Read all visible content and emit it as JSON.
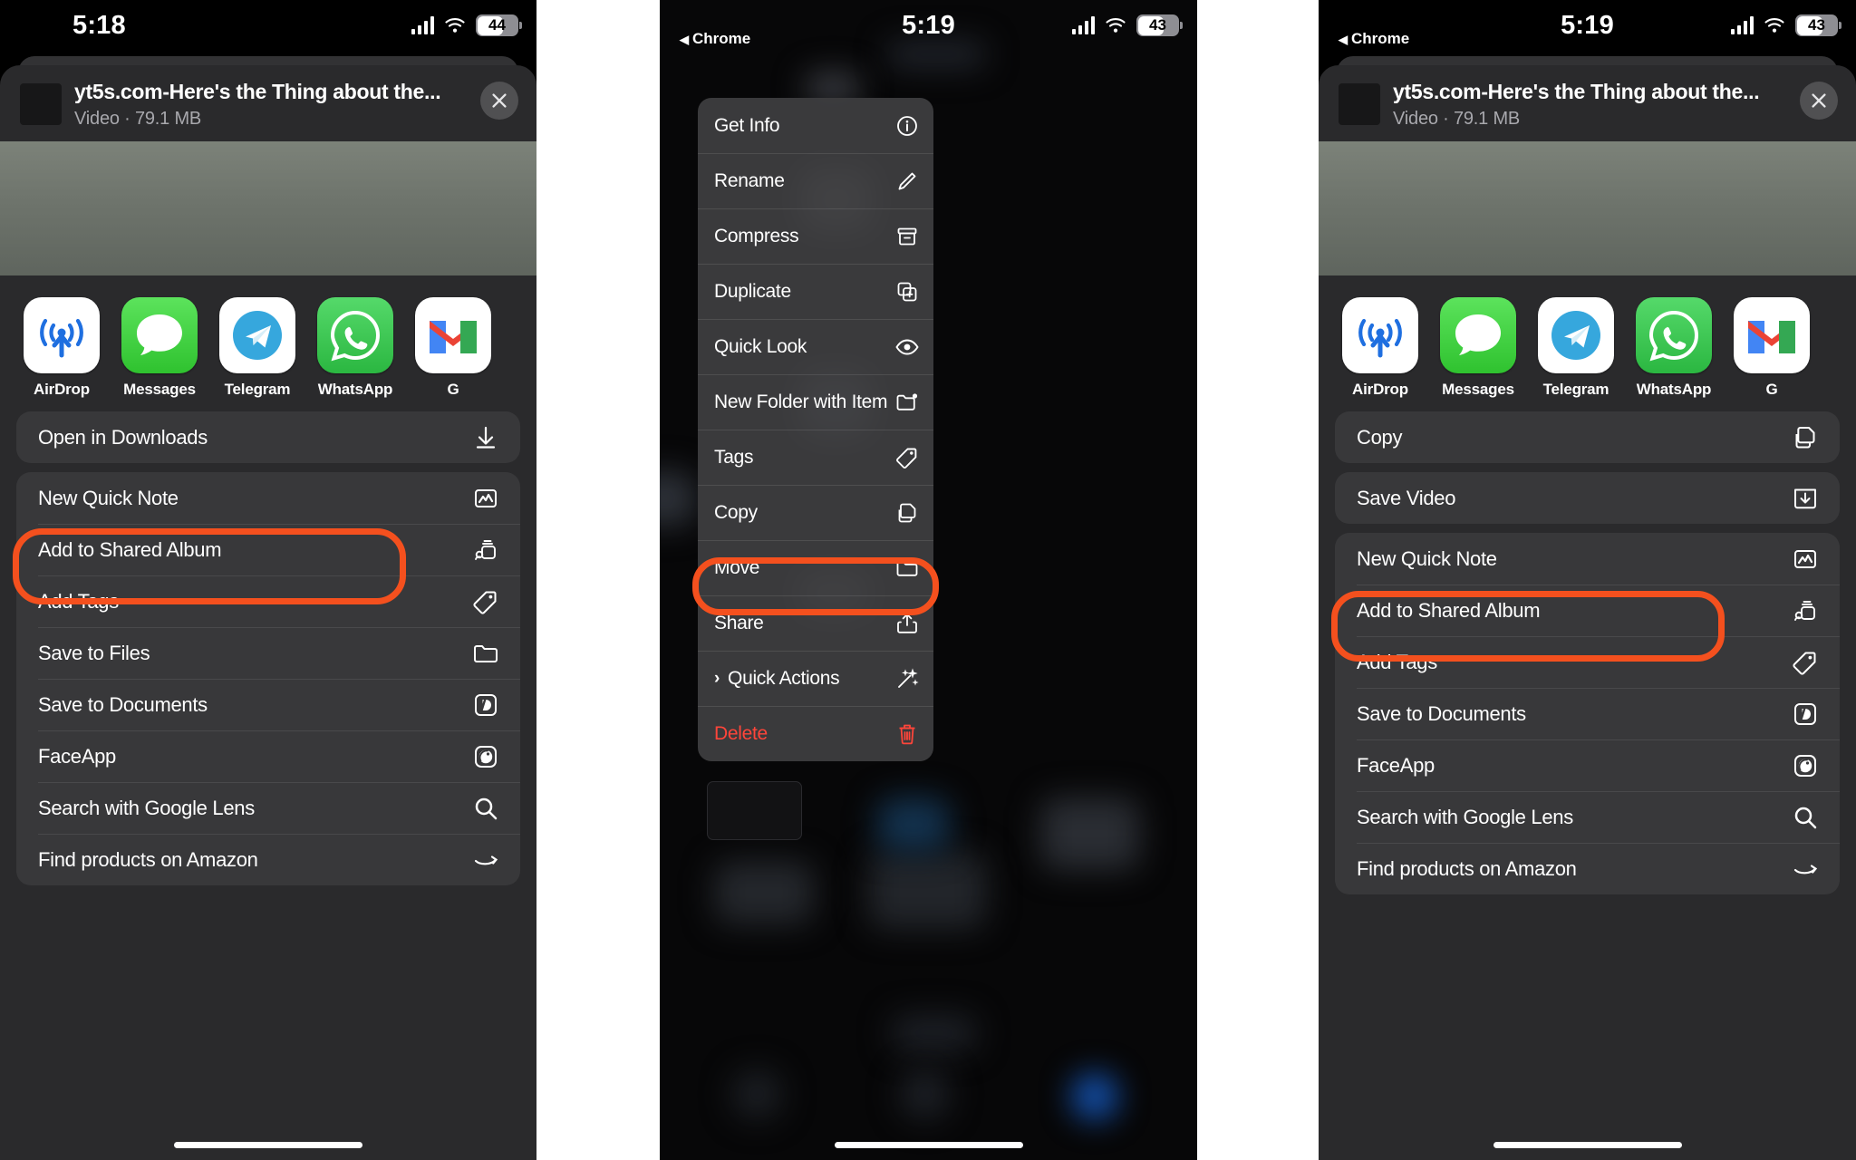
{
  "accent": {
    "highlight_ring": "#f4501e",
    "sheet_bg": "#2a2a2c",
    "row_bg": "#38383a",
    "delete_red": "#ff453a"
  },
  "panel1": {
    "status": {
      "time": "5:18",
      "battery": "44",
      "carrier_bars": 4,
      "wifi": "wifi-icon"
    },
    "header": {
      "title": "yt5s.com-Here's the Thing about the...",
      "subtitle": "Video · 79.1 MB",
      "close": "close-icon"
    },
    "apps": [
      {
        "name": "AirDrop",
        "icon": "airdrop-icon"
      },
      {
        "name": "Messages",
        "icon": "messages-icon"
      },
      {
        "name": "Telegram",
        "icon": "telegram-icon"
      },
      {
        "name": "WhatsApp",
        "icon": "whatsapp-icon"
      },
      {
        "name": "G",
        "icon": "gmail-icon"
      }
    ],
    "highlighted_action": {
      "label": "Open in Downloads",
      "icon": "download-icon"
    },
    "actions": [
      {
        "label": "New Quick Note",
        "icon": "quick-note-icon"
      },
      {
        "label": "Add to Shared Album",
        "icon": "shared-album-icon"
      },
      {
        "label": "Add Tags",
        "icon": "tag-icon"
      },
      {
        "label": "Save to Files",
        "icon": "folder-icon"
      },
      {
        "label": "Save to Documents",
        "icon": "documents-icon"
      },
      {
        "label": "FaceApp",
        "icon": "faceapp-icon"
      },
      {
        "label": "Search with Google Lens",
        "icon": "search-icon"
      },
      {
        "label": "Find products on Amazon",
        "icon": "amazon-icon"
      }
    ]
  },
  "panel2": {
    "status": {
      "time": "5:19",
      "battery": "43",
      "back_app": "Chrome",
      "carrier_bars": 4,
      "wifi": "wifi-icon"
    },
    "context_menu": [
      {
        "label": "Get Info",
        "icon": "info-icon",
        "highlighted": false
      },
      {
        "label": "Rename",
        "icon": "pencil-icon",
        "highlighted": false
      },
      {
        "label": "Compress",
        "icon": "archive-icon",
        "highlighted": false
      },
      {
        "label": "Duplicate",
        "icon": "duplicate-icon",
        "highlighted": false
      },
      {
        "label": "Quick Look",
        "icon": "eye-icon",
        "highlighted": false
      },
      {
        "label": "New Folder with Item",
        "icon": "new-folder-icon",
        "highlighted": false
      },
      {
        "label": "Tags",
        "icon": "tag-icon",
        "highlighted": false
      },
      {
        "label": "Copy",
        "icon": "copy-icon",
        "highlighted": false
      },
      {
        "label": "Move",
        "icon": "folder-icon",
        "highlighted": false
      },
      {
        "label": "Share",
        "icon": "share-icon",
        "highlighted": true
      },
      {
        "label": "Quick Actions",
        "icon": "wand-icon",
        "highlighted": false,
        "submenu": true
      },
      {
        "label": "Delete",
        "icon": "trash-icon",
        "highlighted": false,
        "destructive": true
      }
    ]
  },
  "panel3": {
    "status": {
      "time": "5:19",
      "battery": "43",
      "back_app": "Chrome",
      "carrier_bars": 4,
      "wifi": "wifi-icon"
    },
    "header": {
      "title": "yt5s.com-Here's the Thing about the...",
      "subtitle": "Video · 79.1 MB",
      "close": "close-icon"
    },
    "apps": [
      {
        "name": "AirDrop",
        "icon": "airdrop-icon"
      },
      {
        "name": "Messages",
        "icon": "messages-icon"
      },
      {
        "name": "Telegram",
        "icon": "telegram-icon"
      },
      {
        "name": "WhatsApp",
        "icon": "whatsapp-icon"
      },
      {
        "name": "G",
        "icon": "gmail-icon"
      }
    ],
    "first_action": {
      "label": "Copy",
      "icon": "copy-icon"
    },
    "highlighted_action": {
      "label": "Save Video",
      "icon": "save-video-icon"
    },
    "actions": [
      {
        "label": "New Quick Note",
        "icon": "quick-note-icon"
      },
      {
        "label": "Add to Shared Album",
        "icon": "shared-album-icon"
      },
      {
        "label": "Add Tags",
        "icon": "tag-icon"
      },
      {
        "label": "Save to Documents",
        "icon": "documents-icon"
      },
      {
        "label": "FaceApp",
        "icon": "faceapp-icon"
      },
      {
        "label": "Search with Google Lens",
        "icon": "search-icon"
      },
      {
        "label": "Find products on Amazon",
        "icon": "amazon-icon"
      }
    ]
  }
}
